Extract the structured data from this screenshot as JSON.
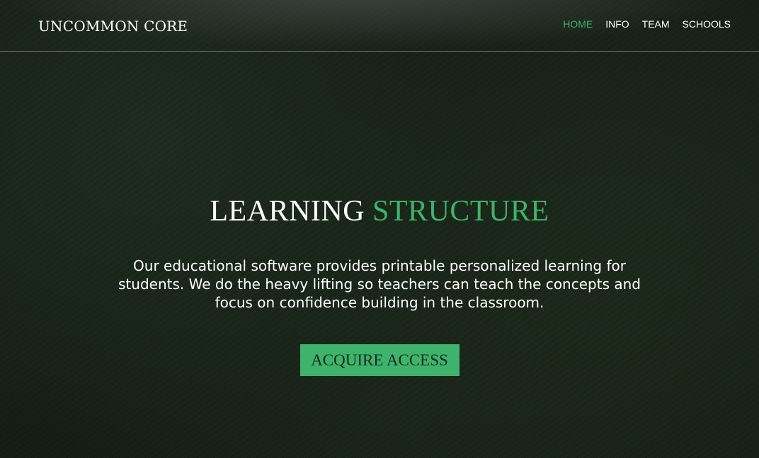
{
  "header": {
    "brand": "UNCOMMON CORE",
    "nav": [
      {
        "label": "HOME",
        "active": true
      },
      {
        "label": "INFO",
        "active": false
      },
      {
        "label": "TEAM",
        "active": false
      },
      {
        "label": "SCHOOLS",
        "active": false
      }
    ]
  },
  "hero": {
    "headline_part1": "LEARNING",
    "headline_part2": "STRUCTURE",
    "subtitle": "Our educational software provides printable personalized learning for students. We do the heavy lifting so teachers can teach the concepts and focus on confidence building in the classroom.",
    "cta_label": "ACQUIRE ACCESS"
  },
  "colors": {
    "accent": "#3db36b",
    "background": "#1c281c",
    "text": "#ffffff"
  }
}
